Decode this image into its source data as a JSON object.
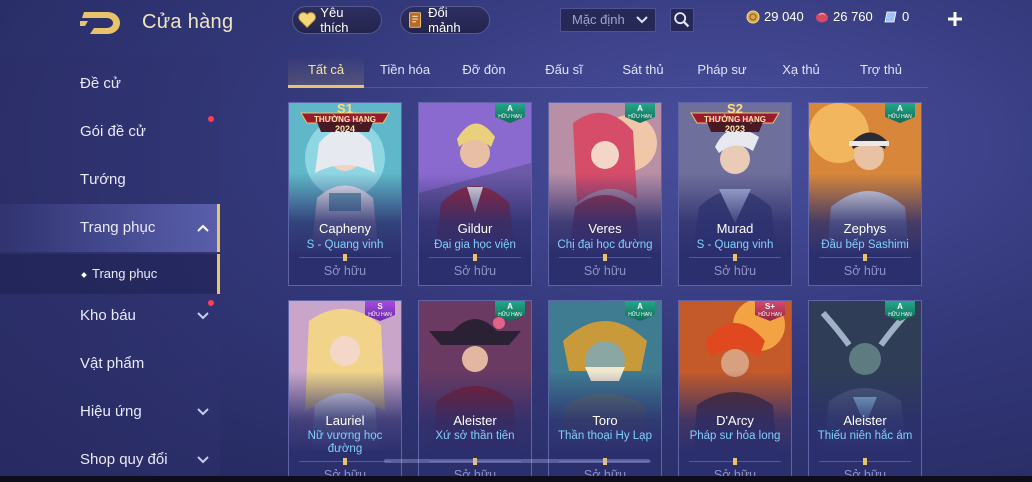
{
  "header": {
    "title": "Cửa hàng",
    "favorite_label": "Yêu thích",
    "fragment_label": "Đổi mảnh",
    "sort_value": "Mặc định",
    "currencies": {
      "gold": "29 040",
      "ruby": "26 760",
      "voucher": "0"
    }
  },
  "sidebar": {
    "items": [
      {
        "label": "Đề cử"
      },
      {
        "label": "Gói đề cử"
      },
      {
        "label": "Tướng"
      },
      {
        "label": "Trang phục"
      },
      {
        "label": "Kho báu"
      },
      {
        "label": "Vật phẩm"
      },
      {
        "label": "Hiệu ứng"
      },
      {
        "label": "Shop quy đổi"
      }
    ],
    "sub_item": "Trang phục"
  },
  "tabs": [
    "Tất cả",
    "Tiền hóa",
    "Đỡ đòn",
    "Đấu sĩ",
    "Sát thủ",
    "Pháp sư",
    "Xạ thủ",
    "Trợ thủ"
  ],
  "cards": [
    {
      "hero": "Capheny",
      "skin": "S - Quang vinh",
      "status": "Sở hữu",
      "badge": {
        "season": "S1",
        "title": "THƯỜNG HẠNG",
        "year": "2024"
      }
    },
    {
      "hero": "Gildur",
      "skin": "Đại gia học viện",
      "status": "Sở hữu",
      "tier": {
        "grade": "A",
        "label": "HỮU HẠN"
      }
    },
    {
      "hero": "Veres",
      "skin": "Chị đại học đường",
      "status": "Sở hữu",
      "tier": {
        "grade": "A",
        "label": "HỮU HẠN"
      }
    },
    {
      "hero": "Murad",
      "skin": "S - Quang vinh",
      "status": "Sở hữu",
      "badge": {
        "season": "S2",
        "title": "THƯỞNG HẠNG",
        "year": "2023"
      }
    },
    {
      "hero": "Zephys",
      "skin": "Đầu bếp Sashimi",
      "status": "Sở hữu",
      "tier": {
        "grade": "A",
        "label": "HỮU HẠN"
      }
    },
    {
      "hero": "Lauriel",
      "skin": "Nữ vương học đường",
      "status": "Sở hữu",
      "tier": {
        "grade": "S",
        "label": "HỮU HẠN"
      }
    },
    {
      "hero": "Aleister",
      "skin": "Xứ sở thần tiên",
      "status": "Sở hữu",
      "tier": {
        "grade": "A",
        "label": "HỮU HẠN"
      }
    },
    {
      "hero": "Toro",
      "skin": "Thần thoại Hy Lạp",
      "status": "Sở hữu",
      "tier": {
        "grade": "A",
        "label": "HỮU HẠN"
      }
    },
    {
      "hero": "D'Arcy",
      "skin": "Pháp sư hỏa long",
      "status": "Sở hữu",
      "tier": {
        "grade": "S+",
        "label": "HỮU HẠN"
      }
    },
    {
      "hero": "Aleister",
      "skin": "Thiếu niên hắc ám",
      "status": "Sở hữu",
      "tier": {
        "grade": "A",
        "label": "HỮU HẠN"
      }
    }
  ],
  "colors": {
    "accent": "#e9c46a",
    "skin_text": "#7fd0ff",
    "notify_dot": "#ff3d57"
  }
}
